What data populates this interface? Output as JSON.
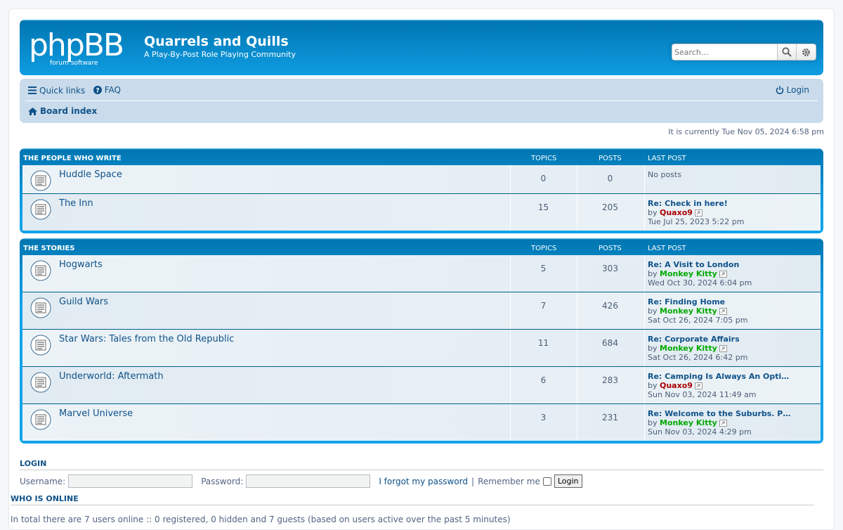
{
  "header": {
    "logo_text": "phpBB",
    "logo_sub": "forum software",
    "site_title": "Quarrels and Quills",
    "site_description": "A Play-By-Post Role Playing Community",
    "search_placeholder": "Search…",
    "search_icon": "magnifier-icon",
    "advanced_search_icon": "gear-icon"
  },
  "nav": {
    "quick_links": "Quick links",
    "faq": "FAQ",
    "login": "Login",
    "board_index": "Board index"
  },
  "datetime": "It is currently Tue Nov 05, 2024 6:58 pm",
  "categories": [
    {
      "title": "THE PEOPLE WHO WRITE",
      "col_topics": "TOPICS",
      "col_posts": "POSTS",
      "col_last": "LAST POST",
      "forums": [
        {
          "name": "Huddle Space",
          "topics": "0",
          "posts": "0",
          "no_posts": "No posts"
        },
        {
          "name": "The Inn",
          "topics": "15",
          "posts": "205",
          "last_title": "Re: Check in here!",
          "by": "by",
          "user": "Quaxo9",
          "date": "Tue Jul 25, 2023 5:22 pm"
        }
      ]
    },
    {
      "title": "THE STORIES",
      "col_topics": "TOPICS",
      "col_posts": "POSTS",
      "col_last": "LAST POST",
      "forums": [
        {
          "name": "Hogwarts",
          "topics": "5",
          "posts": "303",
          "last_title": "Re: A Visit to London",
          "by": "by",
          "user": "Monkey Kitty",
          "date": "Wed Oct 30, 2024 6:04 pm"
        },
        {
          "name": "Guild Wars",
          "topics": "7",
          "posts": "426",
          "last_title": "Re: Finding Home",
          "by": "by",
          "user": "Monkey Kitty",
          "date": "Sat Oct 26, 2024 7:05 pm"
        },
        {
          "name": "Star Wars: Tales from the Old Republic",
          "topics": "11",
          "posts": "684",
          "last_title": "Re: Corporate Affairs",
          "by": "by",
          "user": "Monkey Kitty",
          "date": "Sat Oct 26, 2024 6:42 pm"
        },
        {
          "name": "Underworld: Aftermath",
          "topics": "6",
          "posts": "283",
          "last_title": "Re: Camping Is Always An Opti…",
          "by": "by",
          "user": "Quaxo9",
          "date": "Sun Nov 03, 2024 11:49 am"
        },
        {
          "name": "Marvel Universe",
          "topics": "3",
          "posts": "231",
          "last_title": "Re: Welcome to the Suburbs. P…",
          "by": "by",
          "user": "Monkey Kitty",
          "date": "Sun Nov 03, 2024 4:29 pm"
        }
      ]
    }
  ],
  "login": {
    "title": "LOGIN",
    "username_label": "Username:",
    "password_label": "Password:",
    "forgot": "I forgot my password",
    "separator": "|",
    "remember": "Remember me",
    "button": "Login"
  },
  "online": {
    "title": "WHO IS ONLINE",
    "text": "In total there are 7 users online :: 0 registered, 0 hidden and 7 guests (based on users active over the past 5 minutes)"
  },
  "colors": {
    "header_blue": "#12a3eb",
    "nav_bg": "#cadceb",
    "link_blue": "#105289",
    "user_red": "#aa0000",
    "user_green": "#00aa00"
  }
}
